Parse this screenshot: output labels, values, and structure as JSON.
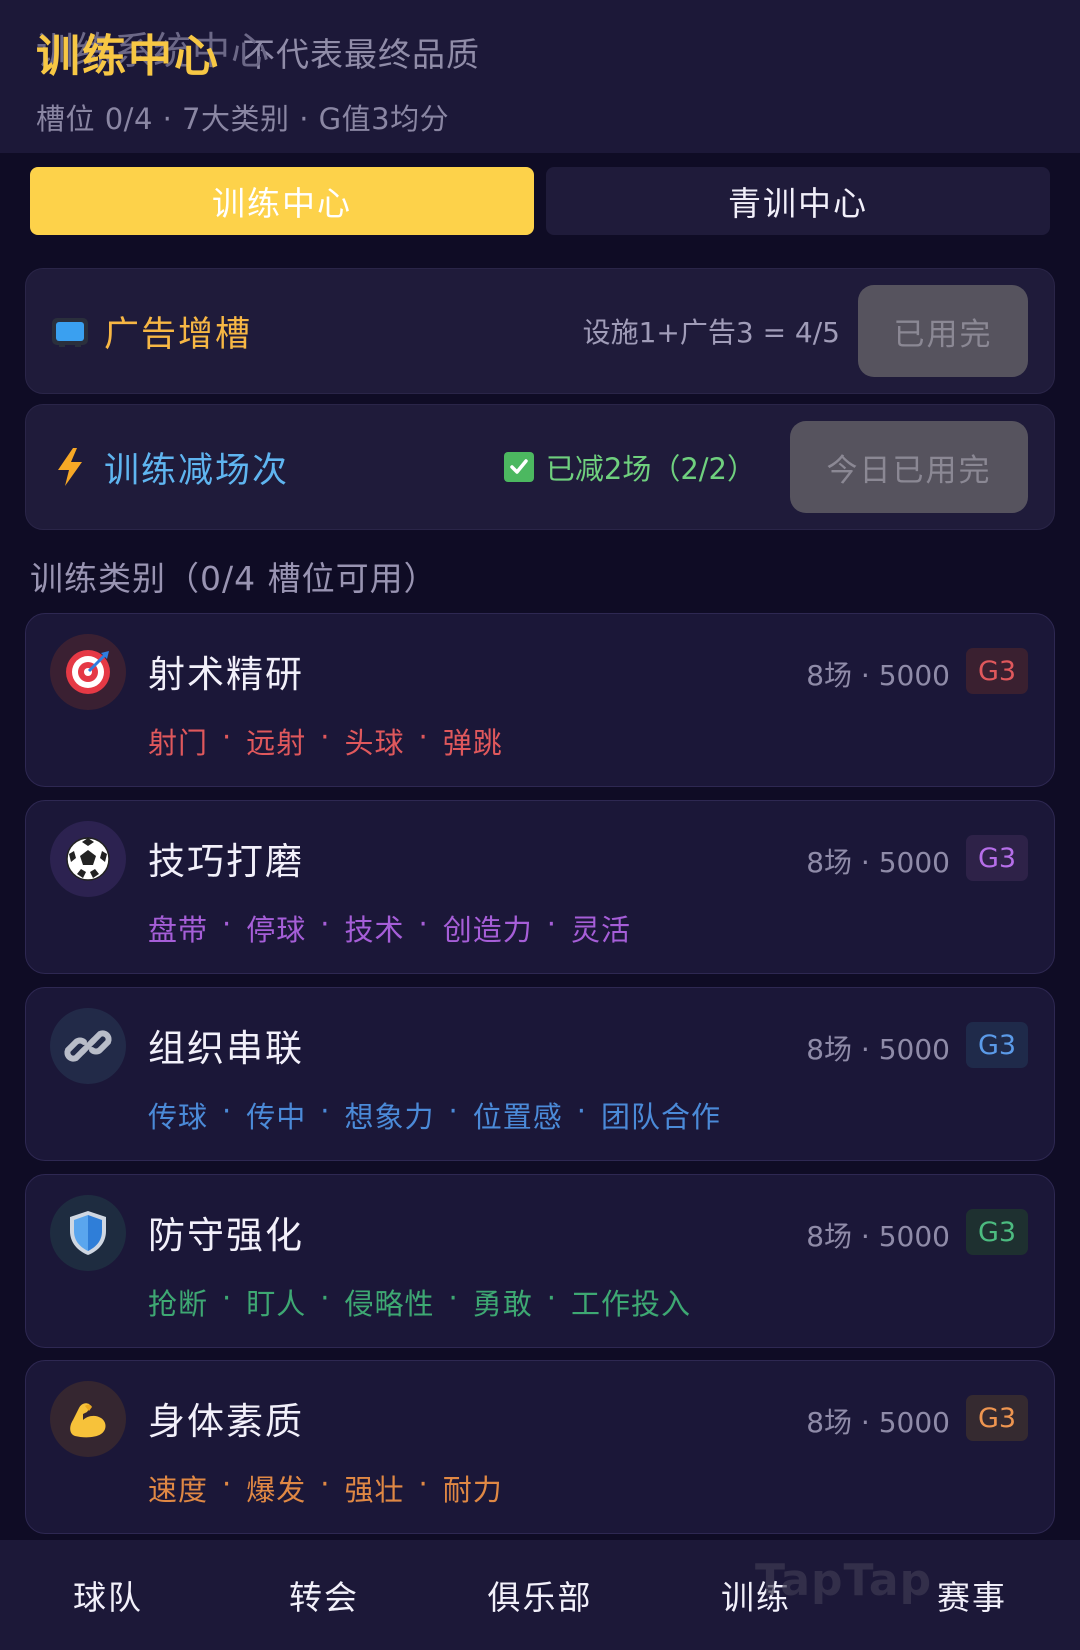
{
  "header": {
    "title": "训练中心",
    "title_ghost": "训练系统中心",
    "note": "不代表最终品质",
    "subtitle": "槽位 0/4 · 7大类别 · G值3均分"
  },
  "tabs": [
    {
      "label": "训练中心",
      "active": true
    },
    {
      "label": "青训中心",
      "active": false
    }
  ],
  "ad_slot": {
    "icon": "tv-icon",
    "label": "广告增槽",
    "label_color": "#f7b744",
    "info": "设施1+广告3 = 4/5",
    "button": "已用完"
  },
  "reduce": {
    "icon": "lightning-icon",
    "label": "训练减场次",
    "label_color": "#5fb5f0",
    "status": "已减2场（2/2）",
    "button": "今日已用完"
  },
  "section_title": "训练类别（0/4 槽位可用）",
  "categories": [
    {
      "icon": "target-icon",
      "name": "射术精研",
      "meta": "8场 · 5000",
      "badge": "G3",
      "color": "#e0585c",
      "tags": [
        "射门",
        "远射",
        "头球",
        "弹跳"
      ]
    },
    {
      "icon": "soccer-ball-icon",
      "name": "技巧打磨",
      "meta": "8场 · 5000",
      "badge": "G3",
      "color": "#a65ed8",
      "tags": [
        "盘带",
        "停球",
        "技术",
        "创造力",
        "灵活"
      ]
    },
    {
      "icon": "link-icon",
      "name": "组织串联",
      "meta": "8场 · 5000",
      "badge": "G3",
      "color": "#4b8ad8",
      "tags": [
        "传球",
        "传中",
        "想象力",
        "位置感",
        "团队合作"
      ]
    },
    {
      "icon": "shield-icon",
      "name": "防守强化",
      "meta": "8场 · 5000",
      "badge": "G3",
      "color": "#3ea873",
      "tags": [
        "抢断",
        "盯人",
        "侵略性",
        "勇敢",
        "工作投入"
      ]
    },
    {
      "icon": "flexed-biceps-icon",
      "name": "身体素质",
      "meta": "8场 · 5000",
      "badge": "G3",
      "color": "#e08844",
      "tags": [
        "速度",
        "爆发",
        "强壮",
        "耐力"
      ]
    }
  ],
  "bottom_nav": [
    "球队",
    "转会",
    "俱乐部",
    "训练",
    "赛事"
  ],
  "watermark": "TapTap"
}
